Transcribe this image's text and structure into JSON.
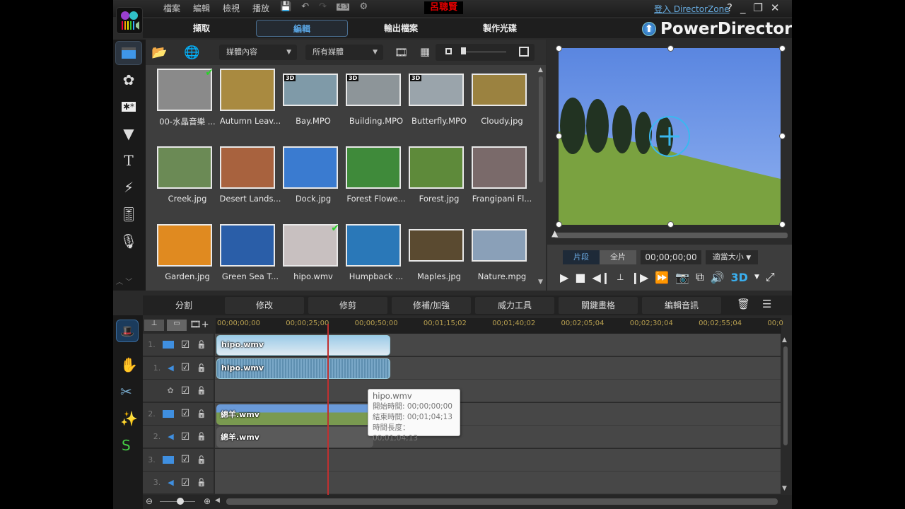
{
  "menu": [
    "檔案",
    "編輯",
    "檢視",
    "播放"
  ],
  "quick_tools": {
    "aspect_ratio": "4:3"
  },
  "project_title": "呂聰賢",
  "login_link": "登入 DirectorZone",
  "window_buttons": {
    "help": "?",
    "minimize": "_",
    "restore": "❐",
    "close": "✕"
  },
  "main_tabs": [
    {
      "label": "擷取",
      "active": false
    },
    {
      "label": "編輯",
      "active": true
    },
    {
      "label": "輸出檔案",
      "active": false
    },
    {
      "label": "製作光碟",
      "active": false
    }
  ],
  "brand": "PowerDirector",
  "library": {
    "content_dropdown": "媒體內容",
    "filter_dropdown": "所有媒體",
    "items": [
      {
        "label": "00-水晶音樂 ...",
        "badge": "",
        "checked": true,
        "color": "#8a8a8a"
      },
      {
        "label": "Autumn Leav...",
        "badge": "",
        "checked": false,
        "color": "#a98a40"
      },
      {
        "label": "Bay.MPO",
        "badge": "3D",
        "checked": false,
        "color": "#7f9aa8"
      },
      {
        "label": "Building.MPO",
        "badge": "3D",
        "checked": false,
        "color": "#8d9599"
      },
      {
        "label": "Butterfly.MPO",
        "badge": "3D",
        "checked": false,
        "color": "#9aa4ab"
      },
      {
        "label": "Cloudy.jpg",
        "badge": "",
        "checked": false,
        "color": "#9b8240"
      },
      {
        "label": "Creek.jpg",
        "badge": "",
        "checked": false,
        "color": "#6b8a55"
      },
      {
        "label": "Desert Lands...",
        "badge": "",
        "checked": false,
        "color": "#a8623e"
      },
      {
        "label": "Dock.jpg",
        "badge": "",
        "checked": false,
        "color": "#3a7bd0"
      },
      {
        "label": "Forest Flowe...",
        "badge": "",
        "checked": false,
        "color": "#3f8a3a"
      },
      {
        "label": "Forest.jpg",
        "badge": "",
        "checked": false,
        "color": "#5e8a3a"
      },
      {
        "label": "Frangipani Fl...",
        "badge": "",
        "checked": false,
        "color": "#7a6a6a"
      },
      {
        "label": "Garden.jpg",
        "badge": "",
        "checked": false,
        "color": "#e08a20"
      },
      {
        "label": "Green Sea T...",
        "badge": "",
        "checked": false,
        "color": "#2a5ea8"
      },
      {
        "label": "hipo.wmv",
        "badge": "",
        "checked": true,
        "color": "#c8c0c0"
      },
      {
        "label": "Humpback ...",
        "badge": "",
        "checked": false,
        "color": "#2a78b8"
      },
      {
        "label": "Maples.jpg",
        "badge": "",
        "checked": false,
        "color": "#5a4a30"
      },
      {
        "label": "Nature.mpg",
        "badge": "",
        "checked": false,
        "color": "#8aa0b8"
      }
    ]
  },
  "preview": {
    "mode_clip": "片段",
    "mode_movie": "全片",
    "timecode": "00;00;00;00",
    "fit_dropdown": "適當大小",
    "stereo": "3D"
  },
  "timeline_tabs": [
    "分割",
    "修改",
    "修剪",
    "修補/加強",
    "威力工具",
    "關鍵畫格",
    "編輯音訊"
  ],
  "ruler_ticks": [
    "00;00;00;00",
    "00;00;25;00",
    "00;00;50;00",
    "00;01;15;02",
    "00;01;40;02",
    "00;02;05;04",
    "00;02;30;04",
    "00;02;55;04",
    "00;0"
  ],
  "tracks": [
    {
      "num": "1.",
      "type": "video",
      "clip": "hipo.wmv"
    },
    {
      "num": "1.",
      "type": "audio",
      "clip": "hipo.wmv"
    },
    {
      "num": "",
      "type": "effect",
      "clip": ""
    },
    {
      "num": "2.",
      "type": "video",
      "clip": "綿羊.wmv"
    },
    {
      "num": "2.",
      "type": "audio",
      "clip": "綿羊.wmv"
    },
    {
      "num": "3.",
      "type": "video",
      "clip": ""
    },
    {
      "num": "3.",
      "type": "audio",
      "clip": ""
    }
  ],
  "tooltip": {
    "title": "hipo.wmv",
    "start": "開始時間: 00;00;00;00",
    "end": "結束時間: 00;01;04;13",
    "duration": "時間長度： 00;01;04;13"
  }
}
